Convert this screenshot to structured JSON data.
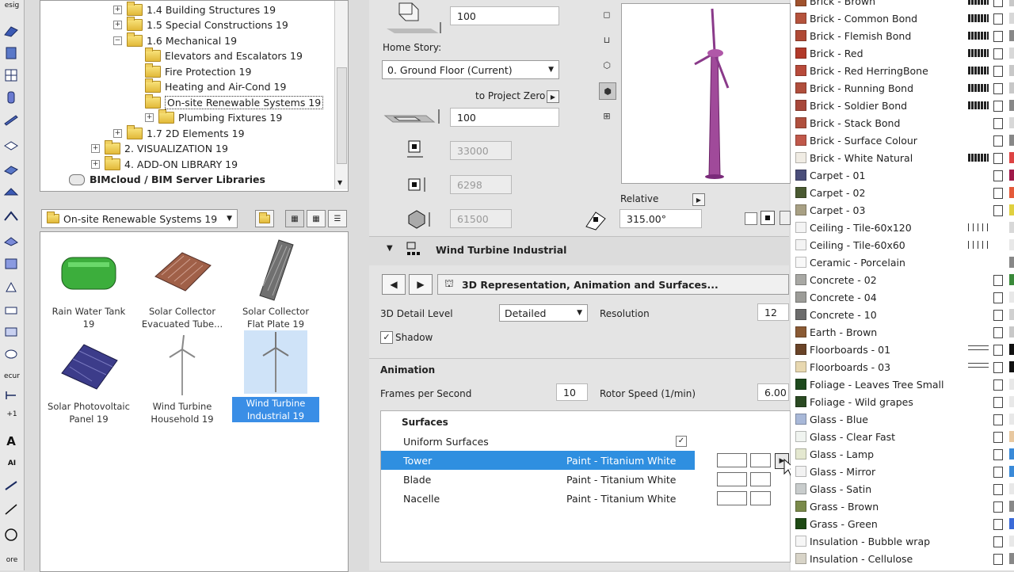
{
  "toolbox": {
    "labels": [
      "esig",
      "ecur",
      "+1",
      "AI",
      "ore"
    ]
  },
  "tree": {
    "items": [
      {
        "label": "1.4 Building Structures 19",
        "indent": 2,
        "expander": "+"
      },
      {
        "label": "1.5 Special Constructions 19",
        "indent": 2,
        "expander": "+"
      },
      {
        "label": "1.6 Mechanical 19",
        "indent": 2,
        "expander": "−"
      },
      {
        "label": "Elevators and Escalators 19",
        "indent": 3,
        "expander": ""
      },
      {
        "label": "Fire Protection 19",
        "indent": 3,
        "expander": ""
      },
      {
        "label": "Heating and Air-Cond 19",
        "indent": 3,
        "expander": ""
      },
      {
        "label": "On-site Renewable Systems 19",
        "indent": 3,
        "expander": "",
        "selected": true
      },
      {
        "label": "Plumbing Fixtures 19",
        "indent": 3,
        "expander": "+"
      },
      {
        "label": "1.7 2D Elements 19",
        "indent": 2,
        "expander": "+"
      },
      {
        "label": "2. VISUALIZATION 19",
        "indent": 1,
        "expander": "+"
      },
      {
        "label": "4. ADD-ON LIBRARY 19",
        "indent": 1,
        "expander": "+"
      },
      {
        "label": "BIMcloud / BIM Server Libraries",
        "indent": 0,
        "expander": "",
        "bold": true
      }
    ]
  },
  "folder_select": {
    "value": "On-site Renewable Systems 19"
  },
  "thumbnails": [
    {
      "line1": "Rain Water Tank",
      "line2": "19",
      "icon": "water-tank"
    },
    {
      "line1": "Solar Collector",
      "line2": "Evacuated Tube...",
      "icon": "solar-collector-tube"
    },
    {
      "line1": "Solar Collector",
      "line2": "Flat Plate 19",
      "icon": "solar-collector-flat"
    },
    {
      "line1": "Solar Photovoltaic",
      "line2": "Panel 19",
      "icon": "solar-panel"
    },
    {
      "line1": "Wind Turbine",
      "line2": "Household 19",
      "icon": "wind-turbine"
    },
    {
      "line1": "Wind Turbine",
      "line2": "Industrial 19",
      "icon": "wind-turbine",
      "selected": true
    }
  ],
  "geometry": {
    "top_offset": "100",
    "home_story_label": "Home Story:",
    "home_story_value": "0. Ground Floor (Current)",
    "to_project_zero": "to Project Zero",
    "base_offset": "100",
    "width": "33000",
    "depth": "6298",
    "height": "61500"
  },
  "preview": {
    "relative_label": "Relative",
    "angle": "315.00°"
  },
  "object": {
    "name": "Wind Turbine Industrial",
    "page_title": "3D Representation, Animation and Surfaces...",
    "detail_label": "3D Detail Level",
    "detail_value": "Detailed",
    "resolution_label": "Resolution",
    "resolution_value": "12",
    "shadow_label": "Shadow",
    "animation_heading": "Animation",
    "fps_label": "Frames per Second",
    "fps_value": "10",
    "rotor_label": "Rotor Speed (1/min)",
    "rotor_value": "6.00"
  },
  "surfaces": {
    "heading": "Surfaces",
    "uniform_label": "Uniform Surfaces",
    "rows": [
      {
        "name": "Tower",
        "material": "Paint - Titanium White",
        "selected": true
      },
      {
        "name": "Blade",
        "material": "Paint - Titanium White"
      },
      {
        "name": "Nacelle",
        "material": "Paint - Titanium White"
      }
    ]
  },
  "materials": [
    {
      "name": "Brick - Brown",
      "color": "#a0522d"
    },
    {
      "name": "Brick - Common Bond",
      "color": "#b5533c"
    },
    {
      "name": "Brick - Flemish Bond",
      "color": "#b04a36"
    },
    {
      "name": "Brick - Red",
      "color": "#b23a2a"
    },
    {
      "name": "Brick - Red HerringBone",
      "color": "#b84a3a"
    },
    {
      "name": "Brick - Running Bond",
      "color": "#b04e3c"
    },
    {
      "name": "Brick - Soldier Bond",
      "color": "#a8483a"
    },
    {
      "name": "Brick - Stack Bond",
      "color": "#b0503e"
    },
    {
      "name": "Brick - Surface Colour",
      "color": "#c0584a"
    },
    {
      "name": "Brick - White Natural",
      "color": "#f0ece4"
    },
    {
      "name": "Carpet - 01",
      "color": "#4a4e7a"
    },
    {
      "name": "Carpet - 02",
      "color": "#4a5a32"
    },
    {
      "name": "Carpet - 03",
      "color": "#a8a084"
    },
    {
      "name": "Ceiling - Tile-60x120",
      "color": "#f4f4f4"
    },
    {
      "name": "Ceiling - Tile-60x60",
      "color": "#f4f4f4"
    },
    {
      "name": "Ceramic - Porcelain",
      "color": "#f8f8f8"
    },
    {
      "name": "Concrete - 02",
      "color": "#a8a8a4"
    },
    {
      "name": "Concrete - 04",
      "color": "#9c9c98"
    },
    {
      "name": "Concrete - 10",
      "color": "#6c6c6c"
    },
    {
      "name": "Earth - Brown",
      "color": "#8a5a34"
    },
    {
      "name": "Floorboards - 01",
      "color": "#6a4428"
    },
    {
      "name": "Floorboards - 03",
      "color": "#e8d8b0"
    },
    {
      "name": "Foliage - Leaves Tree Small",
      "color": "#1e4a1e"
    },
    {
      "name": "Foliage - Wild grapes",
      "color": "#2a4a22"
    },
    {
      "name": "Glass - Blue",
      "color": "#a8b8d8"
    },
    {
      "name": "Glass - Clear Fast",
      "color": "#f0f4f0"
    },
    {
      "name": "Glass - Lamp",
      "color": "#e4e8d0"
    },
    {
      "name": "Glass - Mirror",
      "color": "#f2f2f2"
    },
    {
      "name": "Glass - Satin",
      "color": "#c8cccc"
    },
    {
      "name": "Grass - Brown",
      "color": "#7a8a4a"
    },
    {
      "name": "Grass - Green",
      "color": "#1e4a14"
    },
    {
      "name": "Insulation - Bubble wrap",
      "color": "#f6f6f6"
    },
    {
      "name": "Insulation - Cellulose",
      "color": "#d8d4c8"
    }
  ]
}
